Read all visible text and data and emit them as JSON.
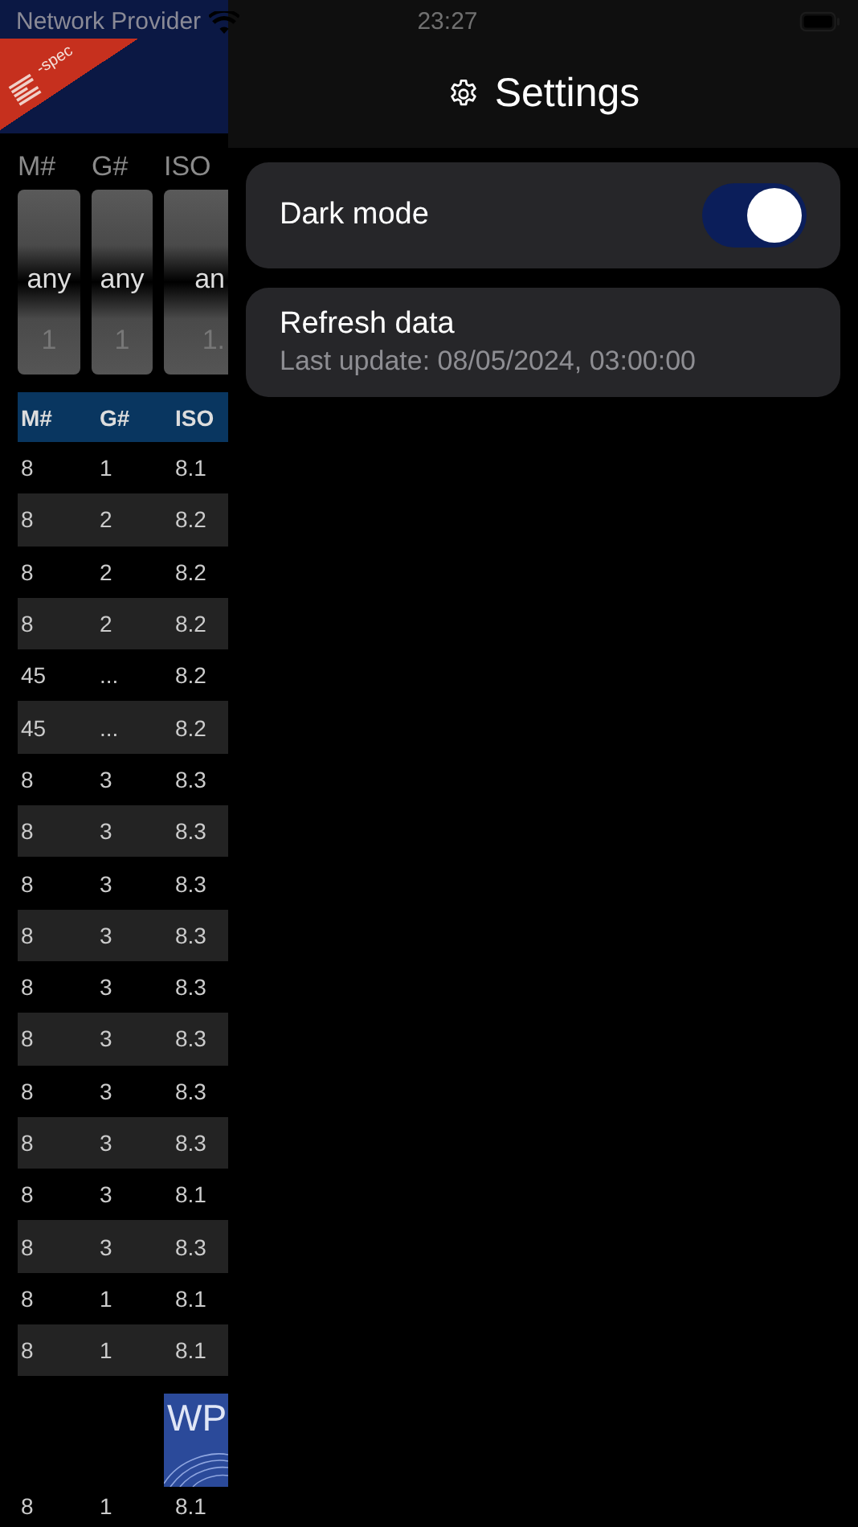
{
  "status_bar": {
    "carrier": "Network Provider",
    "time": "23:27"
  },
  "background_app": {
    "logo": {
      "text": "-spec"
    },
    "filters": [
      {
        "label": "M#",
        "options": [
          {
            "text": "any",
            "selected": true
          },
          {
            "text": "1",
            "selected": false
          }
        ]
      },
      {
        "label": "G#",
        "options": [
          {
            "text": "any",
            "selected": true
          },
          {
            "text": "1",
            "selected": false
          }
        ]
      },
      {
        "label": "ISO",
        "options": [
          {
            "text": "an",
            "selected": true
          },
          {
            "text": "1.",
            "selected": false
          }
        ]
      }
    ],
    "table": {
      "columns": [
        "M#",
        "G#",
        "ISO"
      ],
      "rows": [
        [
          "8",
          "1",
          "8.1"
        ],
        [
          "8",
          "2",
          "8.2"
        ],
        [
          "8",
          "2",
          "8.2"
        ],
        [
          "8",
          "2",
          "8.2"
        ],
        [
          "45",
          "...",
          "8.2"
        ],
        [
          "45",
          "...",
          "8.2"
        ],
        [
          "8",
          "3",
          "8.3"
        ],
        [
          "8",
          "3",
          "8.3"
        ],
        [
          "8",
          "3",
          "8.3"
        ],
        [
          "8",
          "3",
          "8.3"
        ],
        [
          "8",
          "3",
          "8.3"
        ],
        [
          "8",
          "3",
          "8.3"
        ],
        [
          "8",
          "3",
          "8.3"
        ],
        [
          "8",
          "3",
          "8.3"
        ],
        [
          "8",
          "3",
          "8.1"
        ],
        [
          "8",
          "3",
          "8.3"
        ],
        [
          "8",
          "1",
          "8.1"
        ],
        [
          "8",
          "1",
          "8.1"
        ]
      ]
    },
    "footer_logo": {
      "text": "WP"
    },
    "footer_row": [
      "8",
      "1",
      "8.1"
    ]
  },
  "settings": {
    "title": "Settings",
    "items": [
      {
        "kind": "toggle",
        "label": "Dark mode",
        "on": true
      },
      {
        "kind": "action",
        "label": "Refresh data",
        "subtitle": "Last update: 08/05/2024, 03:00:00"
      }
    ]
  }
}
